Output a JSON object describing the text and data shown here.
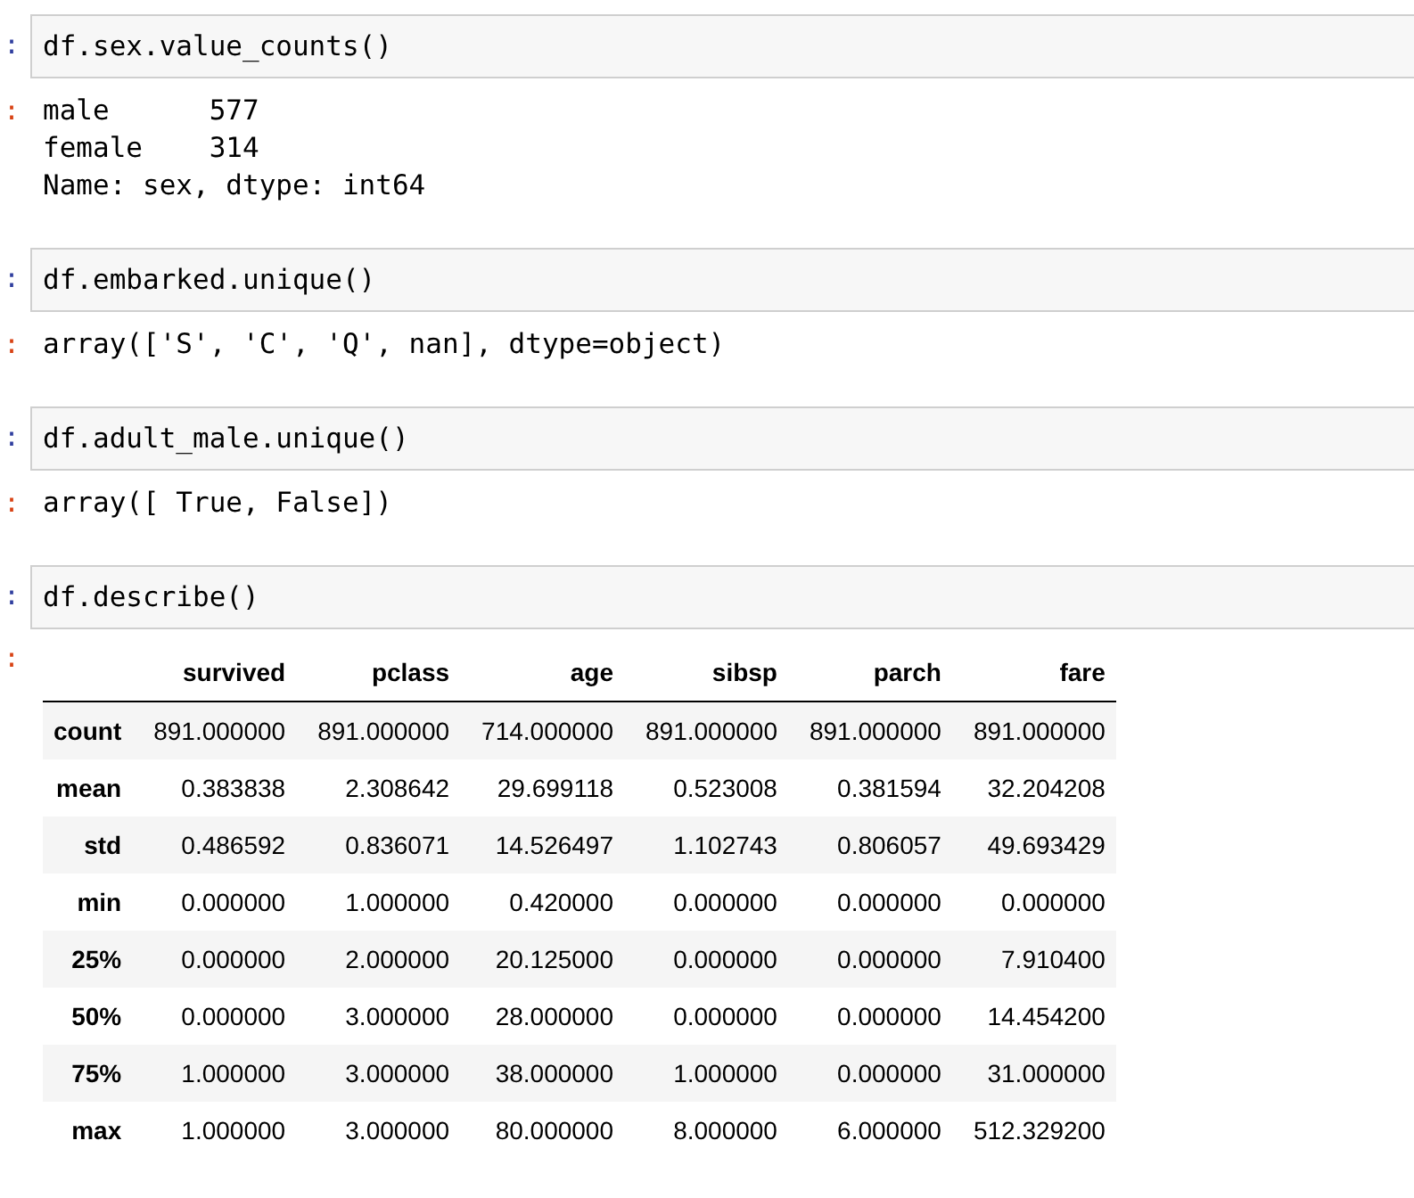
{
  "cells": [
    {
      "kind": "input",
      "prompt": ":",
      "code": "df.sex.value_counts()"
    },
    {
      "kind": "output",
      "prompt": ":",
      "lines": [
        "male      577",
        "female    314",
        "Name: sex, dtype: int64"
      ]
    },
    {
      "kind": "input",
      "prompt": ":",
      "code": "df.embarked.unique()"
    },
    {
      "kind": "output",
      "prompt": ":",
      "lines": [
        "array(['S', 'C', 'Q', nan], dtype=object)"
      ]
    },
    {
      "kind": "input",
      "prompt": ":",
      "code": "df.adult_male.unique()"
    },
    {
      "kind": "output",
      "prompt": ":",
      "lines": [
        "array([ True, False])"
      ]
    },
    {
      "kind": "input",
      "prompt": ":",
      "code": "df.describe()"
    },
    {
      "kind": "table",
      "prompt": ":",
      "columns": [
        "survived",
        "pclass",
        "age",
        "sibsp",
        "parch",
        "fare"
      ],
      "rows": [
        {
          "index": "count",
          "values": [
            "891.000000",
            "891.000000",
            "714.000000",
            "891.000000",
            "891.000000",
            "891.000000"
          ]
        },
        {
          "index": "mean",
          "values": [
            "0.383838",
            "2.308642",
            "29.699118",
            "0.523008",
            "0.381594",
            "32.204208"
          ]
        },
        {
          "index": "std",
          "values": [
            "0.486592",
            "0.836071",
            "14.526497",
            "1.102743",
            "0.806057",
            "49.693429"
          ]
        },
        {
          "index": "min",
          "values": [
            "0.000000",
            "1.000000",
            "0.420000",
            "0.000000",
            "0.000000",
            "0.000000"
          ]
        },
        {
          "index": "25%",
          "values": [
            "0.000000",
            "2.000000",
            "20.125000",
            "0.000000",
            "0.000000",
            "7.910400"
          ]
        },
        {
          "index": "50%",
          "values": [
            "0.000000",
            "3.000000",
            "28.000000",
            "0.000000",
            "0.000000",
            "14.454200"
          ]
        },
        {
          "index": "75%",
          "values": [
            "1.000000",
            "3.000000",
            "38.000000",
            "1.000000",
            "0.000000",
            "31.000000"
          ]
        },
        {
          "index": "max",
          "values": [
            "1.000000",
            "3.000000",
            "80.000000",
            "8.000000",
            "6.000000",
            "512.329200"
          ]
        }
      ]
    }
  ]
}
